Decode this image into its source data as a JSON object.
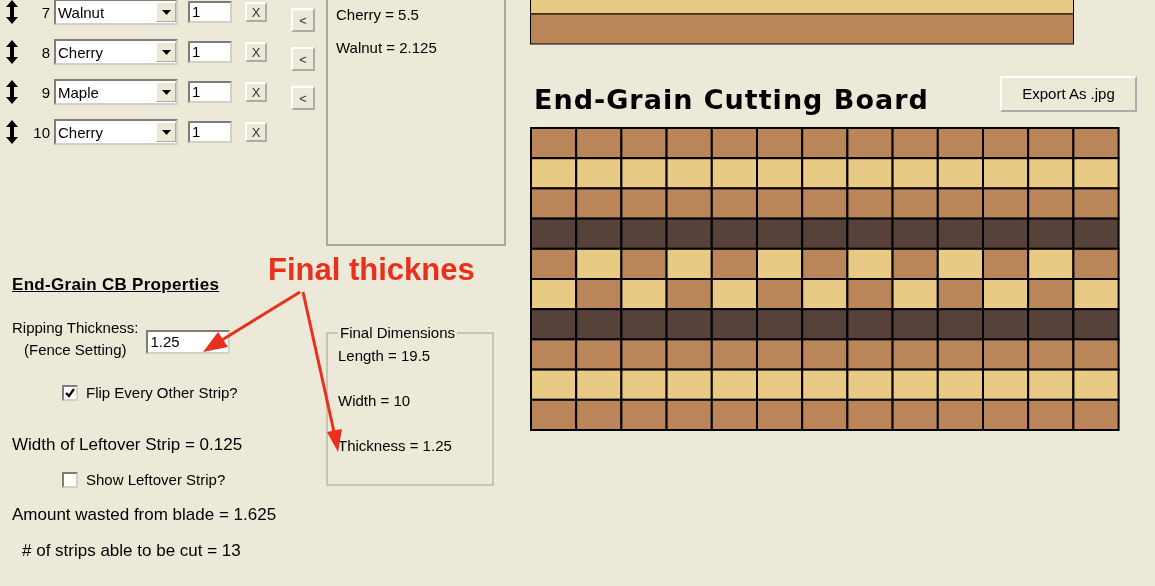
{
  "strips": [
    {
      "number": "7",
      "wood": "Walnut",
      "count": "1",
      "remove": "X"
    },
    {
      "number": "8",
      "wood": "Cherry",
      "count": "1",
      "remove": "X"
    },
    {
      "number": "9",
      "wood": "Maple",
      "count": "1",
      "remove": "X"
    },
    {
      "number": "10",
      "wood": "Cherry",
      "count": "1",
      "remove": "X"
    }
  ],
  "move_buttons": [
    "<",
    "<",
    "<"
  ],
  "totals": [
    "Cherry = 5.5",
    "Walnut = 2.125"
  ],
  "board_title": "End-Grain Cutting Board",
  "export_button": "Export As .jpg",
  "properties": {
    "title": "End-Grain CB Properties",
    "ripping_label": "Ripping Thickness:",
    "ripping_sub": "(Fence Setting)",
    "ripping_value": "1.25",
    "flip": {
      "label": "Flip Every Other Strip?",
      "checked": true
    },
    "leftover_width": "Width of Leftover Strip = 0.125",
    "show_leftover": {
      "label": "Show Leftover Strip?",
      "checked": false
    },
    "waste": "Amount wasted from blade = 1.625",
    "strip_count": "# of strips able to be cut = 13"
  },
  "final_dimensions": {
    "title": "Final Dimensions",
    "lines": [
      "Length = 19.5",
      "Width = 10",
      "Thickness = 1.25"
    ]
  },
  "annotation": {
    "label": "Final thicknes"
  }
}
